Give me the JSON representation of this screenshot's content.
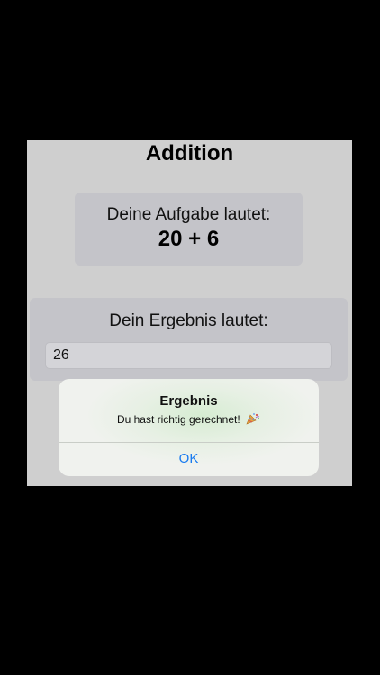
{
  "screen": {
    "title": "Addition",
    "task": {
      "label": "Deine Aufgabe lautet:",
      "expression": "20 + 6"
    },
    "result": {
      "label": "Dein Ergebnis lautet:",
      "input_value": "26"
    }
  },
  "alert": {
    "title": "Ergebnis",
    "message": "Du hast richtig gerechnet!",
    "message_icon": "party-popper-icon",
    "ok_label": "OK"
  },
  "colors": {
    "background": "#000000",
    "screen": "#cfcfcf",
    "card": "#c4c4c9",
    "accent": "#1a7cf0"
  }
}
